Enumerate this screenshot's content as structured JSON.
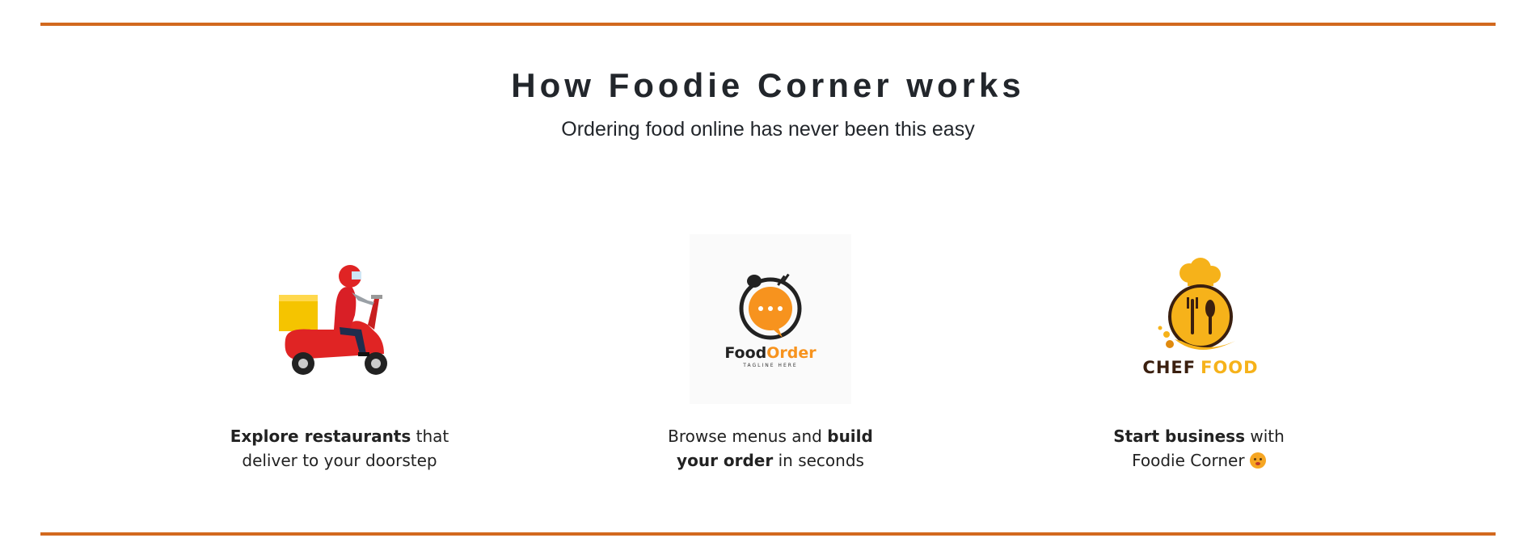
{
  "section": {
    "title": "How Foodie Corner works",
    "subtitle": "Ordering food online has never been this easy"
  },
  "steps": [
    {
      "icon": "delivery-scooter-icon",
      "bold_lead": "Explore restaurants",
      "text_after_lead": " that",
      "line2": "deliver to your doorstep"
    },
    {
      "icon": "food-order-logo-icon",
      "text_before_bold": "Browse menus and ",
      "bold_1": "build",
      "bold_2": "your order",
      "text_after_bold": " in seconds",
      "logo_food": "Food",
      "logo_order": "Order",
      "logo_tagline": "TAGLINE HERE"
    },
    {
      "icon": "chef-food-logo-icon",
      "bold_lead": "Start business",
      "text_after_lead": " with",
      "line2": "Foodie Corner",
      "logo_chef": "CHEF",
      "logo_food": "FOOD"
    }
  ],
  "colors": {
    "accent_rule": "#d2691e",
    "scooter_red": "#e02424",
    "box_yellow": "#f5c400",
    "order_orange": "#f7931e",
    "chef_yellow": "#f6b21a",
    "chef_brown": "#3a1f0f"
  }
}
